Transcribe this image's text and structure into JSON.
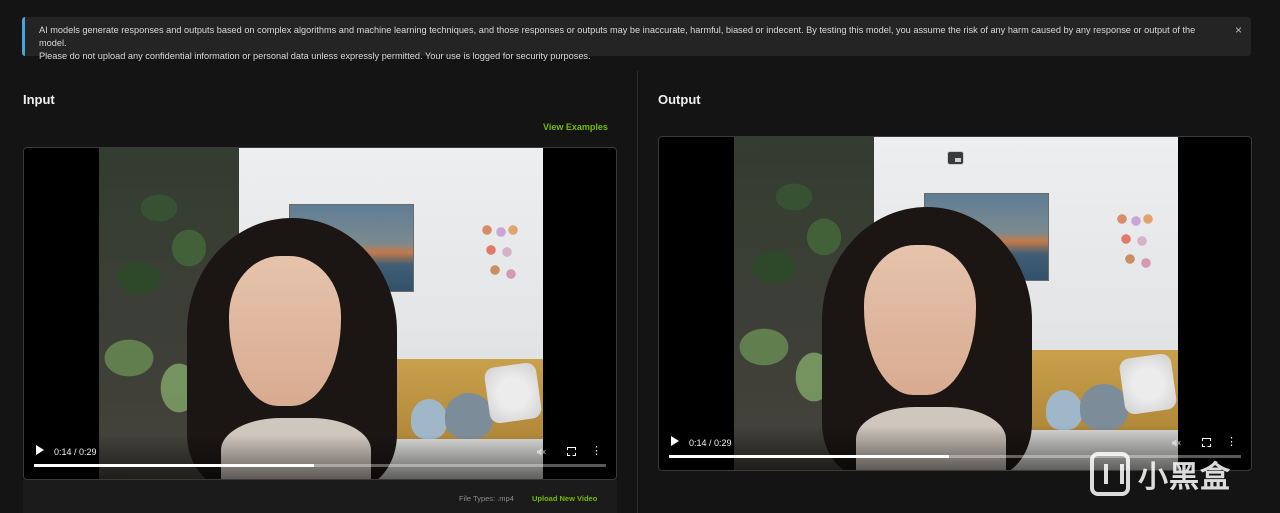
{
  "banner": {
    "text_line1": "AI models generate responses and outputs based on complex algorithms and machine learning techniques, and those responses or outputs may be inaccurate, harmful, biased or indecent. By testing this model, you assume the risk of any harm caused by any response or output of the model.",
    "text_line2": "Please do not upload any confidential information or personal data unless expressly permitted. Your use is logged for security purposes.",
    "close_icon": "×"
  },
  "input": {
    "title": "Input",
    "view_examples": "View Examples",
    "video": {
      "time": "0:14 / 0:29",
      "progress": 0.49,
      "more_icon": "⋮"
    },
    "file_types": "File Types: .mp4",
    "upload_label": "Upload New Video"
  },
  "output": {
    "title": "Output",
    "video": {
      "time": "0:14 / 0:29",
      "progress": 0.49,
      "more_icon": "⋮"
    }
  },
  "watermark": {
    "text": "小黑盒"
  },
  "colors": {
    "accent_green": "#76b900",
    "banner_accent": "#4aa3d9",
    "background": "#141414"
  },
  "icons": [
    "close-icon",
    "play-icon",
    "mute-icon",
    "fullscreen-icon",
    "more-icon",
    "picture-in-picture-icon"
  ]
}
